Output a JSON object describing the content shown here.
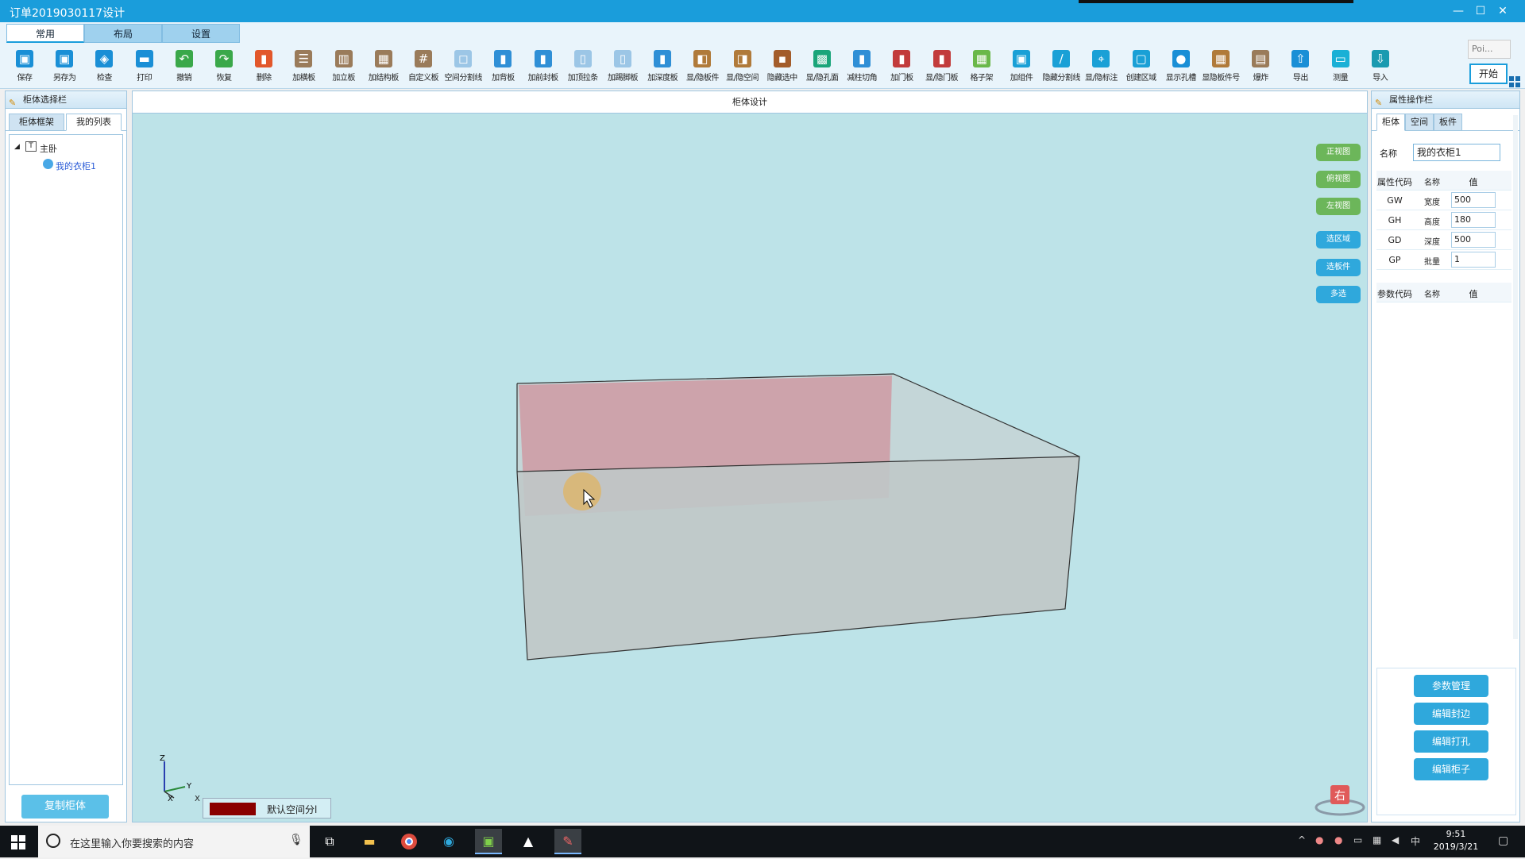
{
  "window": {
    "title": "订单2019030117设计",
    "minimize": "—",
    "maximize": "☐",
    "close": "✕"
  },
  "ribbon": {
    "tabs": [
      "常用",
      "布局",
      "设置"
    ],
    "tools": [
      {
        "label": "保存",
        "icon": "save-icon",
        "color": "#1a8fd6"
      },
      {
        "label": "另存为",
        "icon": "save-as-icon",
        "color": "#1a8fd6"
      },
      {
        "label": "检查",
        "icon": "check-icon",
        "color": "#1a8fd6"
      },
      {
        "label": "打印",
        "icon": "print-icon",
        "color": "#1a8fd6"
      },
      {
        "label": "撤销",
        "icon": "undo-icon",
        "color": "#3aa84a"
      },
      {
        "label": "恢复",
        "icon": "redo-icon",
        "color": "#3aa84a"
      },
      {
        "label": "删除",
        "icon": "delete-icon",
        "color": "#e2572b"
      },
      {
        "label": "加横板",
        "icon": "horizontal-board-icon",
        "color": "#9a7b5a"
      },
      {
        "label": "加立板",
        "icon": "vertical-board-icon",
        "color": "#9a7b5a"
      },
      {
        "label": "加结构板",
        "icon": "structure-board-icon",
        "color": "#9a7b5a"
      },
      {
        "label": "自定义板",
        "icon": "custom-board-icon",
        "color": "#9a7b5a"
      },
      {
        "label": "空间分割线",
        "icon": "space-divide-icon",
        "color": "#9cc6e6"
      },
      {
        "label": "加背板",
        "icon": "back-board-icon",
        "color": "#2f8fd6"
      },
      {
        "label": "加前封板",
        "icon": "front-seal-icon",
        "color": "#2f8fd6"
      },
      {
        "label": "加顶拉条",
        "icon": "top-bar-icon",
        "color": "#9cc6e6"
      },
      {
        "label": "加踢脚板",
        "icon": "kickboard-icon",
        "color": "#9cc6e6"
      },
      {
        "label": "加深度板",
        "icon": "depth-board-icon",
        "color": "#2f8fd6"
      },
      {
        "label": "显/隐板件",
        "icon": "toggle-parts-icon",
        "color": "#b07a3a"
      },
      {
        "label": "显/隐空间",
        "icon": "toggle-space-icon",
        "color": "#b07a3a"
      },
      {
        "label": "隐藏选中",
        "icon": "hide-selected-icon",
        "color": "#a35c2a"
      },
      {
        "label": "显/隐孔面",
        "icon": "toggle-holes-icon",
        "color": "#1aa57a"
      },
      {
        "label": "减柱切角",
        "icon": "corner-cut-icon",
        "color": "#2f8fd6"
      },
      {
        "label": "加门板",
        "icon": "door-board-icon",
        "color": "#c23b3b"
      },
      {
        "label": "显/隐门板",
        "icon": "toggle-door-icon",
        "color": "#c23b3b"
      },
      {
        "label": "格子架",
        "icon": "grid-rack-icon",
        "color": "#6ab84a"
      },
      {
        "label": "加组件",
        "icon": "add-component-icon",
        "color": "#1aa0d6"
      },
      {
        "label": "隐藏分割线",
        "icon": "hide-divider-icon",
        "color": "#1aa0d6"
      },
      {
        "label": "显/隐标注",
        "icon": "toggle-label-icon",
        "color": "#1aa0d6"
      },
      {
        "label": "创建区域",
        "icon": "create-area-icon",
        "color": "#1aa0d6"
      },
      {
        "label": "显示孔槽",
        "icon": "show-slots-icon",
        "color": "#1a8fd6"
      },
      {
        "label": "显隐板件号",
        "icon": "toggle-part-no-icon",
        "color": "#b07a3a"
      },
      {
        "label": "爆炸",
        "icon": "explode-icon",
        "color": "#9a7b5a"
      },
      {
        "label": "导出",
        "icon": "export-icon",
        "color": "#1a8fd6"
      },
      {
        "label": "测量",
        "icon": "measure-icon",
        "color": "#1ab0d6"
      },
      {
        "label": "导入",
        "icon": "import-icon",
        "color": "#1a9ab0"
      }
    ],
    "poi_label": "Poi...",
    "start_label": "开始"
  },
  "left_panel": {
    "title": "柜体选择栏",
    "tabs": [
      "柜体框架",
      "我的列表"
    ],
    "tree_root": "主卧",
    "tree_child": "我的衣柜1",
    "copy_button": "复制柜体"
  },
  "center": {
    "title": "柜体设计",
    "view_buttons": [
      "正视图",
      "俯视图",
      "左视图"
    ],
    "select_buttons": [
      "选区域",
      "选板件",
      "多选"
    ],
    "legend_label": "默认空间分l",
    "legend_color": "#8a0000",
    "corner_label": "右",
    "axes": {
      "z": "Z",
      "y": "Y",
      "x": "X"
    }
  },
  "right_panel": {
    "title": "属性操作栏",
    "tabs": [
      "柜体",
      "空间",
      "板件"
    ],
    "name_label": "名称",
    "name_value": "我的衣柜1",
    "attr_header": [
      "属性代码",
      "名称",
      "值"
    ],
    "attrs": [
      {
        "code": "GW",
        "name": "宽度",
        "value": "500"
      },
      {
        "code": "GH",
        "name": "高度",
        "value": "180"
      },
      {
        "code": "GD",
        "name": "深度",
        "value": "500"
      },
      {
        "code": "GP",
        "name": "批量",
        "value": "1"
      }
    ],
    "param_header": [
      "参数代码",
      "名称",
      "值"
    ],
    "actions": [
      "参数管理",
      "编辑封边",
      "编辑打孔",
      "编辑柜子"
    ]
  },
  "taskbar": {
    "search_placeholder": "在这里输入你要搜索的内容",
    "time": "9:51",
    "date": "2019/3/21",
    "ime": "中"
  }
}
